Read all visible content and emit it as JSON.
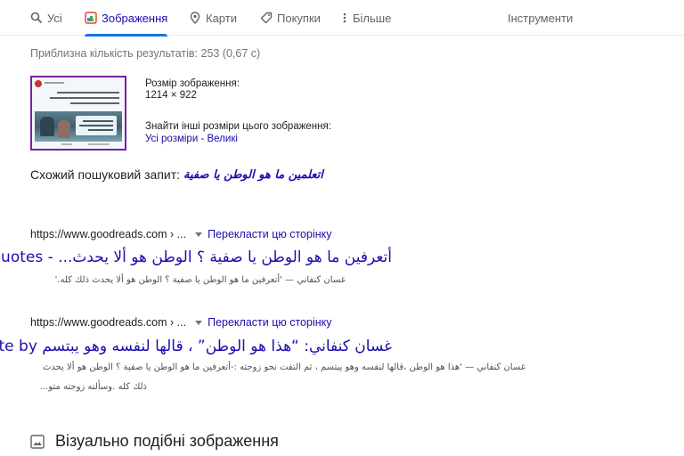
{
  "tabs": [
    {
      "label": "Усі",
      "icon": "search-icon"
    },
    {
      "label": "Зображення",
      "icon": "images-icon",
      "active": true
    },
    {
      "label": "Карти",
      "icon": "map-pin-icon"
    },
    {
      "label": "Покупки",
      "icon": "tag-icon"
    },
    {
      "label": "Більше",
      "icon": "more-vert-icon"
    }
  ],
  "tools_label": "Інструменти",
  "stats": "Приблизна кількість результатів: 253 (0,67 с)",
  "image_info": {
    "size_label": "Розмір зображення:",
    "size_value": "1214 × 922",
    "other_sizes_label": "Знайти інші розміри цього зображення:",
    "all_sizes": "Усі розміри",
    "separator": " - ",
    "large": "Великі"
  },
  "related": {
    "label": "Схожий пошуковий запит:",
    "query": "اتعلمين ما هو الوطن يا صفية"
  },
  "results": [
    {
      "url": "https://www.goodreads.com › ...",
      "translate": "Перекласти цю сторінку",
      "title": "أتعرفين ما هو الوطن يا صفية ؟ الوطن هو ألا يحدث... - Quotes",
      "snippet": [
        "غسان كنفاني — 'أتعرفين ما هو الوطن يا صفية ؟ الوطن هو ألا يحدث ذلك كله.'"
      ]
    },
    {
      "url": "https://www.goodreads.com › ...",
      "translate": "Перекласти цю сторінку",
      "title": "غسان كنفاني: “هذا هو الوطن” ، قالها لنفسه وهو يبتسم Quote by",
      "snippet": [
        "غسان كنفاني — 'هذا هو الوطن ،قالها لنفسه وهو يبتسم ، ثم التفت نحو زوجته :-أتعرفين ما هو الوطن يا صفية ؟ الوطن هو ألا يحدث",
        "ذلك كله .وسألته زوجته متو..."
      ]
    }
  ],
  "similar_heading": "Візуально подібні зображення",
  "colors": {
    "link": "#1a0dab",
    "accent": "#1a73e8",
    "thumb_border": "#7b1fa2"
  }
}
